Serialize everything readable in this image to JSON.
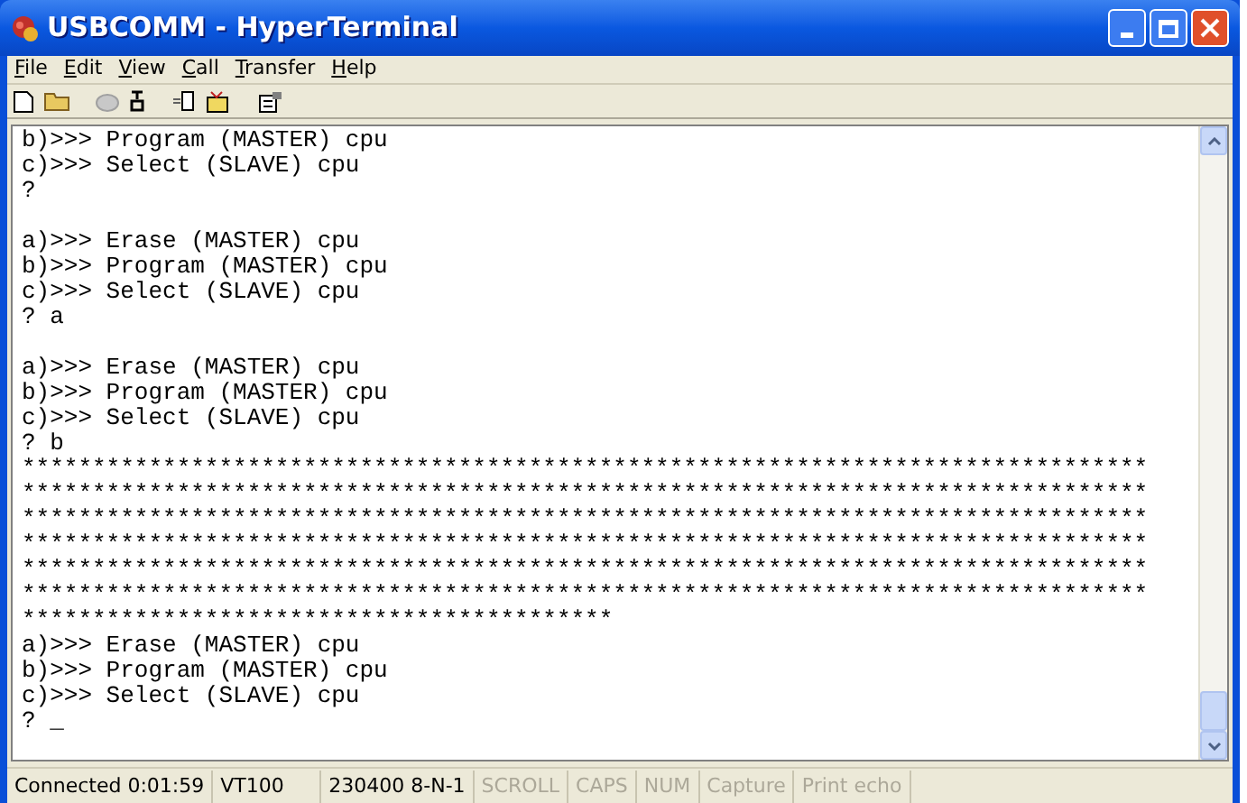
{
  "window": {
    "title": "USBCOMM - HyperTerminal"
  },
  "menu": [
    {
      "label": "File"
    },
    {
      "label": "Edit"
    },
    {
      "label": "View"
    },
    {
      "label": "Call"
    },
    {
      "label": "Transfer"
    },
    {
      "label": "Help"
    }
  ],
  "terminal": {
    "blocks": [
      {
        "lines": [
          "b)>>> Program (MASTER) cpu",
          "c)>>> Select (SLAVE) cpu",
          "?"
        ]
      },
      {
        "lines": [
          "a)>>> Erase (MASTER) cpu",
          "b)>>> Program (MASTER) cpu",
          "c)>>> Select (SLAVE) cpu",
          "? a"
        ]
      },
      {
        "lines": [
          "a)>>> Erase (MASTER) cpu",
          "b)>>> Program (MASTER) cpu",
          "c)>>> Select (SLAVE) cpu",
          "? b",
          "********************************************************************************",
          "********************************************************************************",
          "********************************************************************************",
          "********************************************************************************",
          "********************************************************************************",
          "********************************************************************************",
          "******************************************",
          "a)>>> Erase (MASTER) cpu",
          "b)>>> Program (MASTER) cpu",
          "c)>>> Select (SLAVE) cpu",
          "? _"
        ]
      }
    ]
  },
  "status_bar": [
    {
      "text": "Connected 0:01:59",
      "disabled": false
    },
    {
      "text": "VT100",
      "disabled": false
    },
    {
      "text": "230400 8-N-1",
      "disabled": false
    },
    {
      "text": "SCROLL",
      "disabled": true
    },
    {
      "text": "CAPS",
      "disabled": true
    },
    {
      "text": "NUM",
      "disabled": true
    },
    {
      "text": "Capture",
      "disabled": true
    },
    {
      "text": "Print echo",
      "disabled": true
    }
  ]
}
